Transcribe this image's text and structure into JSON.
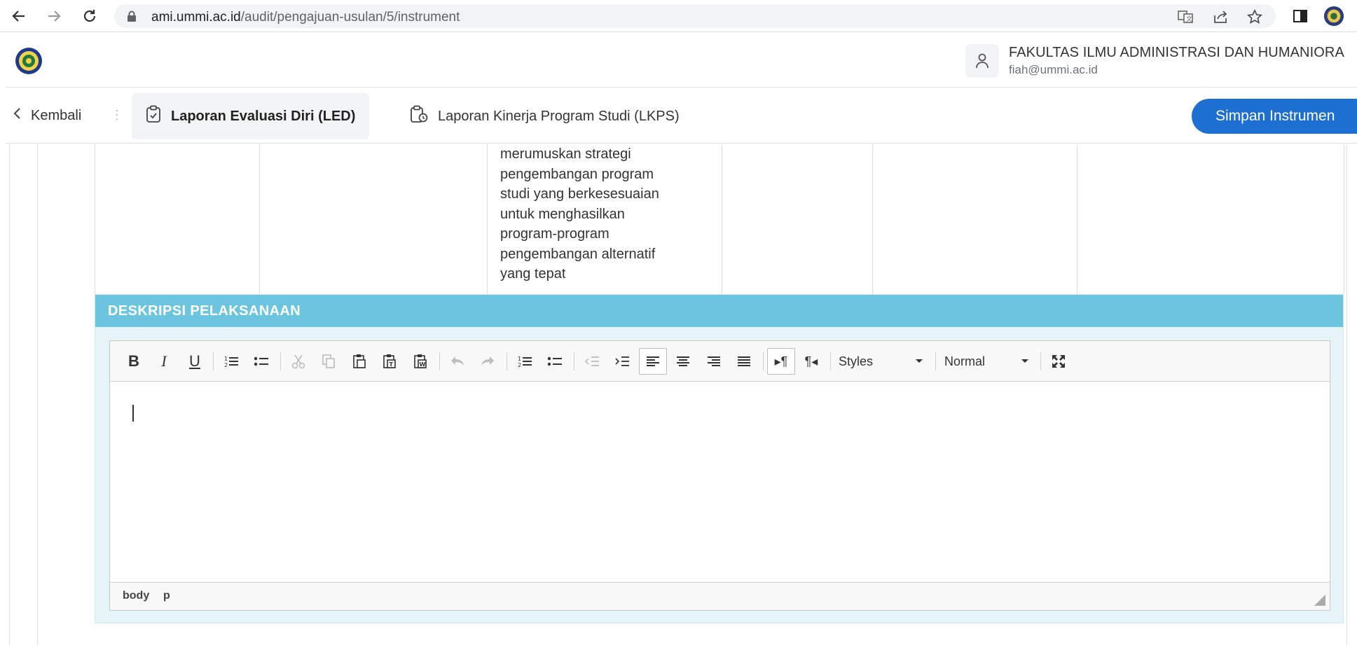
{
  "browser": {
    "url_host": "ami.ummi.ac.id",
    "url_path": "/audit/pengajuan-usulan/5/instrument"
  },
  "header": {
    "user_name": "FAKULTAS ILMU ADMINISTRASI DAN HUMANIORA",
    "user_email": "fiah@ummi.ac.id"
  },
  "tabbar": {
    "back_label": "Kembali",
    "tabs": [
      {
        "label": "Laporan Evaluasi Diri (LED)",
        "active": true
      },
      {
        "label": "Laporan Kinerja Program Studi (LKPS)",
        "active": false
      }
    ],
    "save_label": "Simpan Instrumen"
  },
  "table": {
    "row_text": [
      "merumuskan strategi",
      "pengembangan program",
      "studi yang berkesesuaian",
      "untuk menghasilkan",
      "program-program",
      "pengembangan alternatif",
      "yang tepat"
    ]
  },
  "section": {
    "title": "DESKRIPSI PELAKSANAAN"
  },
  "editor": {
    "styles_label": "Styles",
    "format_label": "Normal",
    "path": [
      "body",
      "p"
    ]
  },
  "colors": {
    "primary": "#1d6fd1",
    "section_header": "#6cc5de",
    "section_bg": "#e6f4f8"
  }
}
